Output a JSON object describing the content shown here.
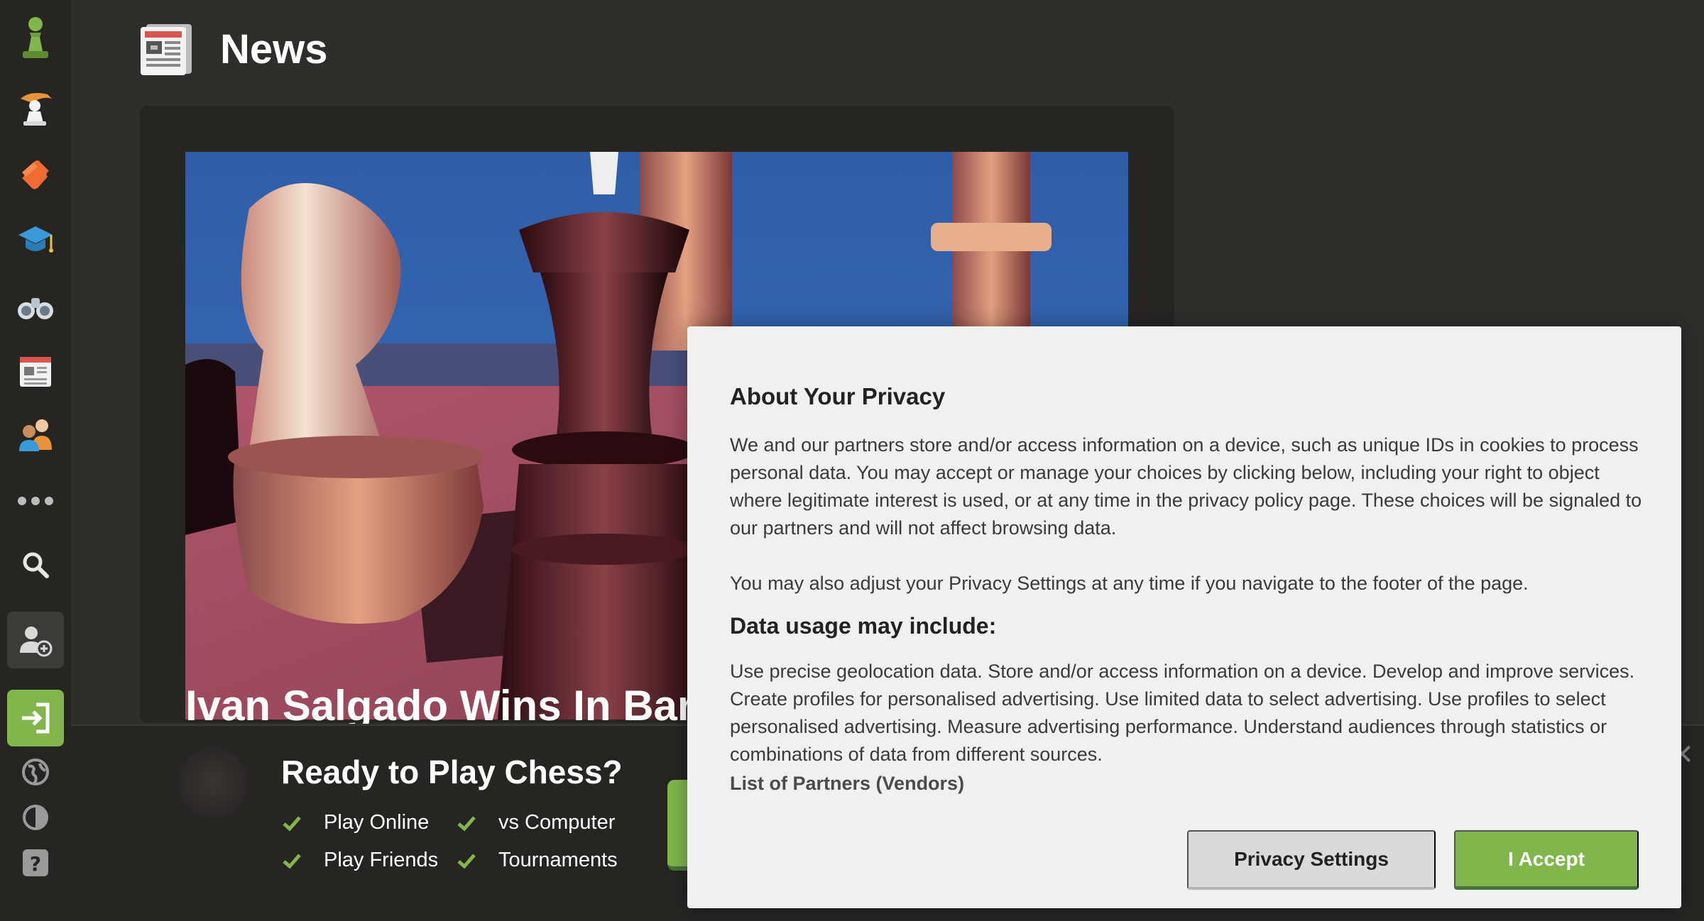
{
  "header": {
    "title": "News",
    "icon": "newspaper-icon"
  },
  "sidebar": {
    "items": [
      {
        "name": "logo-pawn-icon"
      },
      {
        "name": "play-icon"
      },
      {
        "name": "puzzles-icon"
      },
      {
        "name": "learn-icon"
      },
      {
        "name": "watch-icon"
      },
      {
        "name": "news-icon"
      },
      {
        "name": "social-icon"
      },
      {
        "name": "more-icon"
      },
      {
        "name": "search-icon"
      },
      {
        "name": "sign-up-icon"
      },
      {
        "name": "log-in-icon"
      },
      {
        "name": "language-icon"
      },
      {
        "name": "theme-icon"
      },
      {
        "name": "help-icon"
      }
    ]
  },
  "article": {
    "headline": "Ivan Salgado Wins In Bar"
  },
  "banner": {
    "title": "Ready to Play Chess?",
    "items": [
      "Play Online",
      "vs Computer",
      "Play Friends",
      "Tournaments"
    ]
  },
  "privacy": {
    "title": "About Your Privacy",
    "paragraph1": "We and our partners store and/or access information on a device, such as unique IDs in cookies to process personal data. You may accept or manage your choices by clicking below, including your right to object where legitimate interest is used, or at any time in the privacy policy page. These choices will be signaled to our partners and will not affect browsing data.",
    "paragraph2": "You may also adjust your Privacy Settings at any time if you navigate to the footer of the page.",
    "subtitle": "Data usage may include:",
    "paragraph3": "Use precise geolocation data. Store and/or access information on a device. Develop and improve services. Create profiles for personalised advertising. Use limited data to select advertising. Use profiles to select personalised advertising. Measure advertising performance. Understand audiences through statistics or combinations of data from different sources.",
    "partners_link": "List of Partners (Vendors)",
    "settings_button": "Privacy Settings",
    "accept_button": "I Accept"
  },
  "colors": {
    "brand_green": "#81b64c",
    "background": "#302e2b",
    "sidebar": "#262522"
  }
}
